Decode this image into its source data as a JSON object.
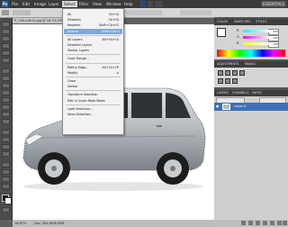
{
  "menubar": {
    "logo": "Ps",
    "items": [
      "File",
      "Edit",
      "Image",
      "Layer",
      "Select",
      "Filter",
      "View",
      "Window",
      "Help"
    ],
    "active_index": 4,
    "workspace": "ESSENTIALS"
  },
  "document": {
    "tab_title": "P_118.x.bk11.jpg @ 16.7% (RG...",
    "zoom": "16.67%",
    "doc_info": "Doc: 384.9K/6.59M"
  },
  "select_menu": {
    "items": [
      {
        "label": "All",
        "shortcut": "Ctrl+A"
      },
      {
        "label": "Deselect",
        "shortcut": "Ctrl+D"
      },
      {
        "label": "Reselect",
        "shortcut": "Shift+Ctrl+D"
      },
      {
        "label": "Inverse",
        "shortcut": "Shift+Ctrl+I"
      },
      {
        "sep": true
      },
      {
        "label": "All Layers",
        "shortcut": "Alt+Ctrl+A"
      },
      {
        "label": "Deselect Layers",
        "shortcut": ""
      },
      {
        "label": "Similar Layers",
        "shortcut": ""
      },
      {
        "sep": true
      },
      {
        "label": "Color Range...",
        "shortcut": ""
      },
      {
        "sep": true
      },
      {
        "label": "Refine Edge...",
        "shortcut": "Alt+Ctrl+R"
      },
      {
        "label": "Modify",
        "shortcut": "▸"
      },
      {
        "sep": true
      },
      {
        "label": "Grow",
        "shortcut": ""
      },
      {
        "label": "Similar",
        "shortcut": ""
      },
      {
        "sep": true
      },
      {
        "label": "Transform Selection",
        "shortcut": ""
      },
      {
        "label": "Edit in Quick Mask Mode",
        "shortcut": ""
      },
      {
        "sep": true
      },
      {
        "label": "Load Selection...",
        "shortcut": ""
      },
      {
        "label": "Save Selection...",
        "shortcut": ""
      }
    ],
    "highlighted_index": 3
  },
  "panels": {
    "color": {
      "tabs": [
        "COLOR",
        "SWATCHES",
        "STYLES"
      ],
      "channels": [
        "R",
        "G",
        "B"
      ],
      "values": [
        "255",
        "255",
        "255"
      ]
    },
    "adjustments": {
      "tabs": [
        "ADJUSTMENTS",
        "MASKS"
      ]
    },
    "layers": {
      "tabs": [
        "LAYERS",
        "CHANNELS",
        "PATHS"
      ],
      "layer_name": "Layer 0"
    }
  },
  "colors": {
    "menubar": "#3a3a3a",
    "highlight": "#7fa7d8",
    "layer_selected": "#3f6fb6",
    "car_body": "#b8bcc0"
  }
}
